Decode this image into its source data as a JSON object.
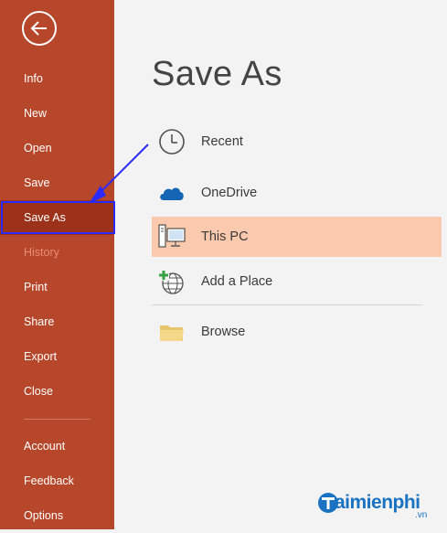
{
  "sidebar": {
    "items": [
      {
        "label": "Info"
      },
      {
        "label": "New"
      },
      {
        "label": "Open"
      },
      {
        "label": "Save"
      },
      {
        "label": "Save As"
      },
      {
        "label": "History"
      },
      {
        "label": "Print"
      },
      {
        "label": "Share"
      },
      {
        "label": "Export"
      },
      {
        "label": "Close"
      },
      {
        "label": "Account"
      },
      {
        "label": "Feedback"
      },
      {
        "label": "Options"
      }
    ],
    "selected_item": "Save As",
    "disabled_item": "History"
  },
  "main": {
    "title": "Save As",
    "locations": [
      {
        "label": "Recent",
        "icon": "clock-icon"
      },
      {
        "label": "OneDrive",
        "icon": "cloud-icon"
      },
      {
        "label": "This PC",
        "icon": "computer-icon"
      },
      {
        "label": "Add a Place",
        "icon": "globe-add-icon"
      },
      {
        "label": "Browse",
        "icon": "folder-icon"
      }
    ],
    "selected_location": "This PC"
  },
  "watermark": {
    "text": "aimienphi",
    "suffix": ".vn"
  },
  "colors": {
    "sidebar_bg": "#b7472a",
    "sidebar_selected": "#9c3219",
    "location_selected": "#fbc9ad",
    "annotation": "#2a2aff",
    "watermark": "#1a73c2"
  }
}
